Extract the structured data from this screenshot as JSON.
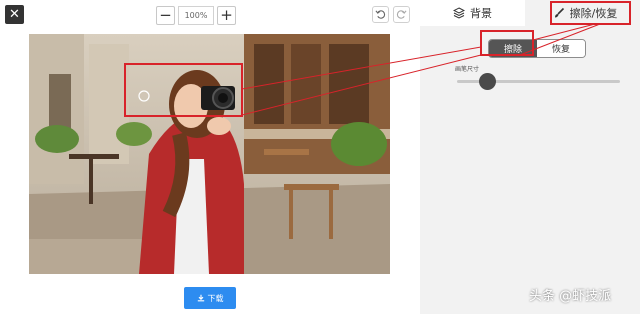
{
  "toolbar": {
    "close_icon": "close-icon",
    "zoom_out": "−",
    "zoom_value": "100%",
    "zoom_in": "+",
    "undo_icon": "undo-icon",
    "redo_icon": "redo-icon"
  },
  "panel": {
    "tabs": [
      {
        "label": "背景",
        "icon": "layers-icon"
      },
      {
        "label": "擦除/恢复",
        "icon": "brush-icon"
      }
    ],
    "mode": {
      "erase": "擦除",
      "restore": "恢复",
      "selected": "擦除"
    },
    "brush_size_label": "画笔尺寸",
    "brush_size_fraction": 0.15
  },
  "download_label": "下载",
  "watermark": "头条 @虾技派",
  "colors": {
    "accent": "#2d8cf0",
    "annotation": "#d8232a",
    "dark": "#555555"
  }
}
